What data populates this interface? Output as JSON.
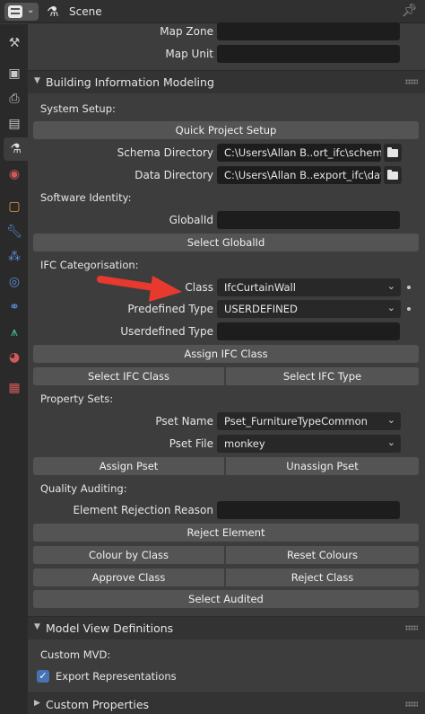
{
  "header": {
    "title": "Scene"
  },
  "top_fields": [
    {
      "label": "Map Zone",
      "value": ""
    },
    {
      "label": "Map Unit",
      "value": ""
    }
  ],
  "bim_panel": {
    "title": "Building Information Modeling",
    "system_setup": {
      "heading": "System Setup:",
      "quick_setup_button": "Quick Project Setup",
      "schema_dir_label": "Schema Directory",
      "schema_dir_value": "C:\\Users\\Allan B..ort_ifc\\schema/",
      "data_dir_label": "Data Directory",
      "data_dir_value": "C:\\Users\\Allan B..export_ifc\\data/"
    },
    "software_identity": {
      "heading": "Software Identity:",
      "globalid_label": "GlobalId",
      "globalid_value": "",
      "select_globalid_button": "Select GlobalId"
    },
    "ifc_categorisation": {
      "heading": "IFC Categorisation:",
      "class_label": "Class",
      "class_value": "IfcCurtainWall",
      "predefined_type_label": "Predefined Type",
      "predefined_type_value": "USERDEFINED",
      "userdefined_type_label": "Userdefined Type",
      "userdefined_type_value": "",
      "assign_class_button": "Assign IFC Class",
      "select_class_button": "Select IFC Class",
      "select_type_button": "Select IFC Type"
    },
    "property_sets": {
      "heading": "Property Sets:",
      "pset_name_label": "Pset Name",
      "pset_name_value": "Pset_FurnitureTypeCommon",
      "pset_file_label": "Pset File",
      "pset_file_value": "monkey",
      "assign_pset_button": "Assign Pset",
      "unassign_pset_button": "Unassign Pset"
    },
    "quality_auditing": {
      "heading": "Quality Auditing:",
      "rejection_reason_label": "Element Rejection Reason",
      "rejection_reason_value": "",
      "reject_element_button": "Reject Element",
      "colour_by_class_button": "Colour by Class",
      "reset_colours_button": "Reset Colours",
      "approve_class_button": "Approve Class",
      "reject_class_button": "Reject Class",
      "select_audited_button": "Select Audited"
    }
  },
  "mvd_panel": {
    "title": "Model View Definitions",
    "custom_mvd_heading": "Custom MVD:",
    "export_representations_label": "Export Representations",
    "export_representations_checked": true
  },
  "custom_properties_panel": {
    "title": "Custom Properties"
  },
  "tabs": [
    {
      "icon": "tool-icon",
      "color": "#c9c9c9",
      "active": false
    },
    {
      "icon": "render-icon",
      "color": "#c9c9c9",
      "active": false
    },
    {
      "icon": "output-icon",
      "color": "#c9c9c9",
      "active": false
    },
    {
      "icon": "view-layer-icon",
      "color": "#c9c9c9",
      "active": false
    },
    {
      "icon": "scene-icon",
      "color": "#e0e0e0",
      "active": true
    },
    {
      "icon": "world-icon",
      "color": "#d05a5a",
      "active": false
    },
    {
      "icon": "object-icon",
      "color": "#e8993a",
      "active": false
    },
    {
      "icon": "modifier-icon",
      "color": "#5a8fd6",
      "active": false
    },
    {
      "icon": "particles-icon",
      "color": "#5a8fd6",
      "active": false
    },
    {
      "icon": "physics-icon",
      "color": "#5a8fd6",
      "active": false
    },
    {
      "icon": "constraints-icon",
      "color": "#5a8fd6",
      "active": false
    },
    {
      "icon": "data-icon",
      "color": "#4cc38a",
      "active": false
    },
    {
      "icon": "material-icon",
      "color": "#d05a5a",
      "active": false
    },
    {
      "icon": "texture-icon",
      "color": "#d05a5a",
      "active": false
    }
  ]
}
